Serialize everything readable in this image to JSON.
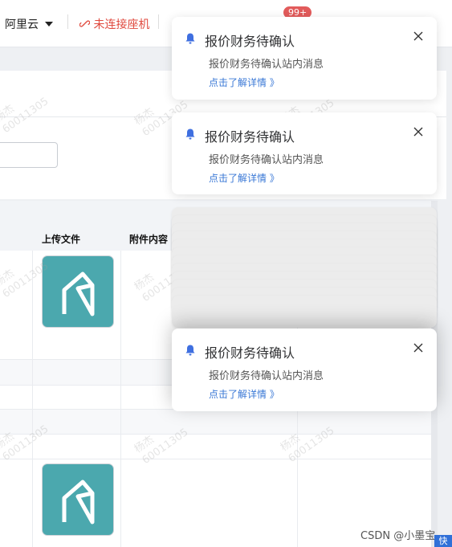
{
  "topbar": {
    "cloud_label": "阿里云",
    "unconnected_label": "未连接座机",
    "badge_count": "99+"
  },
  "table": {
    "headers": [
      "上传文件",
      "附件内容"
    ]
  },
  "watermark": {
    "name": "杨杰",
    "number": "60011305"
  },
  "notifications": [
    {
      "title": "报价财务待确认",
      "message": "报价财务待确认站内消息",
      "link": "点击了解详情 》"
    },
    {
      "title": "报价财务待确认",
      "message": "报价财务待确认站内消息",
      "link": "点击了解详情 》"
    },
    {
      "title": "报价财务待确认",
      "message": "报价财务待确认站内消息",
      "link": "点击了解详情 》"
    }
  ],
  "footer": {
    "credit": "CSDN @小墨宝",
    "side_button": "快"
  },
  "colors": {
    "accent_blue": "#3a78d6",
    "bell_blue": "#3f6fe0",
    "unconnected_red": "#e04a3f",
    "badge_red": "#e25b5b",
    "thumb_teal": "#4ba8ae"
  }
}
